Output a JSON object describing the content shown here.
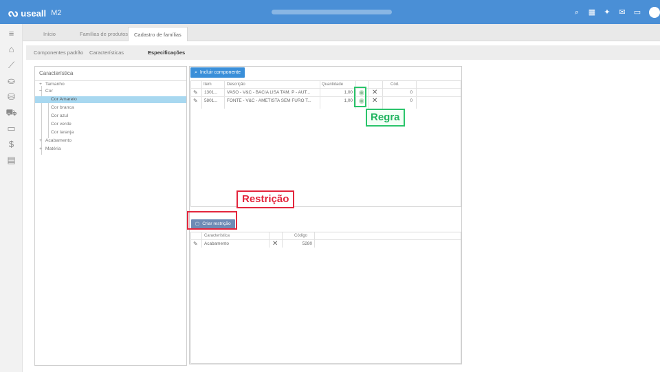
{
  "header": {
    "brand": "useall",
    "product": "M2",
    "icons": [
      "search-icon",
      "grid-icon",
      "shirt-icon",
      "mail-icon",
      "chat-icon",
      "user-avatar"
    ]
  },
  "sidebar": {
    "icons": [
      "menu-icon",
      "home-icon",
      "chart-icon",
      "basket-icon",
      "coins-icon",
      "cart-icon",
      "card-icon",
      "dollar-icon",
      "calculator-icon"
    ]
  },
  "tabs": [
    {
      "label": "Início"
    },
    {
      "label": "Famílias de produtos"
    },
    {
      "label": "Cadastro de famílias"
    }
  ],
  "subtabs": [
    {
      "label": "Componentes padrão"
    },
    {
      "label": "Características"
    },
    {
      "label": "Especificações"
    }
  ],
  "left_panel": {
    "title": "Característica",
    "tree": [
      {
        "label": "Tamanho",
        "prefix": "+"
      },
      {
        "label": "Cor",
        "prefix": "−"
      },
      {
        "label": "Cor Amarelo",
        "prefix": "",
        "selected": true
      },
      {
        "label": "Cor branca",
        "prefix": ""
      },
      {
        "label": "Cor azul",
        "prefix": ""
      },
      {
        "label": "Cor verde",
        "prefix": ""
      },
      {
        "label": "Cor laranja",
        "prefix": ""
      },
      {
        "label": "Acabamento",
        "prefix": "+"
      },
      {
        "label": "Matéria",
        "prefix": "+"
      }
    ]
  },
  "components": {
    "add_button": "Incluir componente",
    "columns": [
      "Item",
      "Descrição",
      "Quantidade",
      "Cód."
    ],
    "rows": [
      {
        "item": "1301...",
        "description": "VASO - V&C - BACIA LISA TAM. P - AUT...",
        "quantity": "1,00",
        "code": "0"
      },
      {
        "item": "5801...",
        "description": "FONTE - V&C - AMETISTA SEM FURO T...",
        "quantity": "1,00",
        "code": "0"
      }
    ]
  },
  "restrictions": {
    "create_button": "Criar restrição",
    "columns": [
      "Característica",
      "Código"
    ],
    "rows": [
      {
        "characteristic": "Acabamento",
        "code": "5280"
      }
    ]
  },
  "annotations": {
    "rule_label": "Regra",
    "restriction_label": "Restrição",
    "colors": {
      "rule": "#29c46a",
      "restriction": "#e3253c"
    }
  }
}
